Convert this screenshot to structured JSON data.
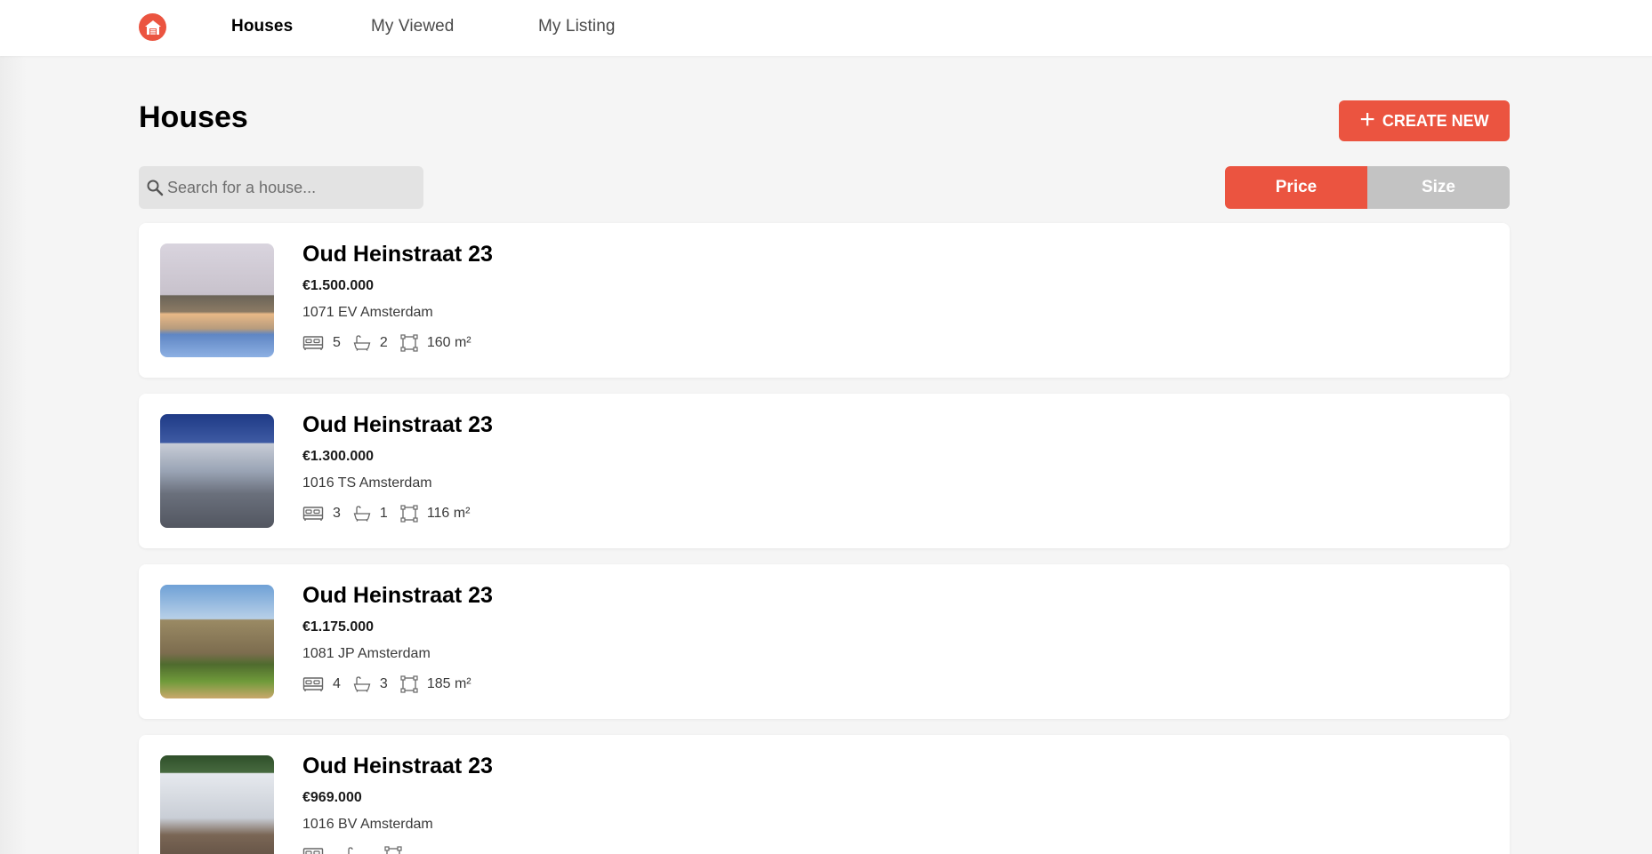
{
  "nav": {
    "items": [
      {
        "label": "Houses",
        "active": true
      },
      {
        "label": "My Viewed",
        "active": false
      },
      {
        "label": "My Listing",
        "active": false
      }
    ]
  },
  "header": {
    "title": "Houses",
    "create_label": "CREATE NEW"
  },
  "search": {
    "placeholder": "Search for a house...",
    "value": ""
  },
  "sort": {
    "options": [
      "Price",
      "Size"
    ],
    "selected": "Price"
  },
  "listings": [
    {
      "title": "Oud Heinstraat 23",
      "price": "€1.500.000",
      "address": "1071 EV Amsterdam",
      "bedrooms": "5",
      "bathrooms": "2",
      "size": "160 m²"
    },
    {
      "title": "Oud Heinstraat 23",
      "price": "€1.300.000",
      "address": "1016 TS Amsterdam",
      "bedrooms": "3",
      "bathrooms": "1",
      "size": "116 m²"
    },
    {
      "title": "Oud Heinstraat 23",
      "price": "€1.175.000",
      "address": "1081 JP Amsterdam",
      "bedrooms": "4",
      "bathrooms": "3",
      "size": "185 m²"
    },
    {
      "title": "Oud Heinstraat 23",
      "price": "€969.000",
      "address": "1016 BV Amsterdam",
      "bedrooms": "",
      "bathrooms": "",
      "size": ""
    }
  ],
  "colors": {
    "accent": "#eb5440",
    "inactive": "#c3c3c3",
    "background": "#f5f5f5"
  },
  "icons": {
    "logo": "house-icon",
    "search": "search-icon",
    "create": "plus-icon",
    "bedrooms": "bed-icon",
    "bathrooms": "bath-icon",
    "size": "area-icon"
  }
}
